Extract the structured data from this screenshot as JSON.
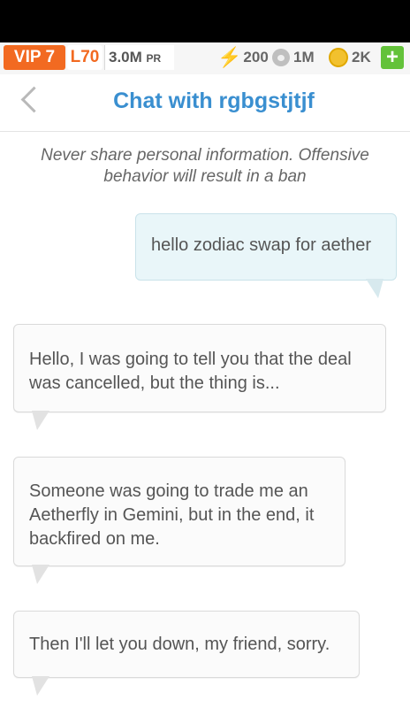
{
  "topbar": {
    "vip": "VIP 7",
    "level": "L70",
    "pr_value": "3.0M",
    "pr_unit": "PR",
    "energy": "200",
    "food": "1M",
    "gold": "2K",
    "add": "+"
  },
  "header": {
    "title": "Chat with rgbgstjtjf"
  },
  "notice": "Never share personal information. Offensive behavior will result in a ban",
  "messages": [
    {
      "side": "out",
      "text": "hello zodiac swap for aether"
    },
    {
      "side": "in",
      "text": "Hello, I was going to tell you that the deal was cancelled, but the thing is..."
    },
    {
      "side": "in",
      "text": "Someone was going to trade me an Aetherfly in Gemini, but in the end, it backfired on me."
    },
    {
      "side": "in",
      "text": "Then I'll let you down, my friend, sorry."
    }
  ],
  "colors": {
    "accent": "#3a8fd0",
    "vip": "#f26a21",
    "add": "#63c23a"
  }
}
